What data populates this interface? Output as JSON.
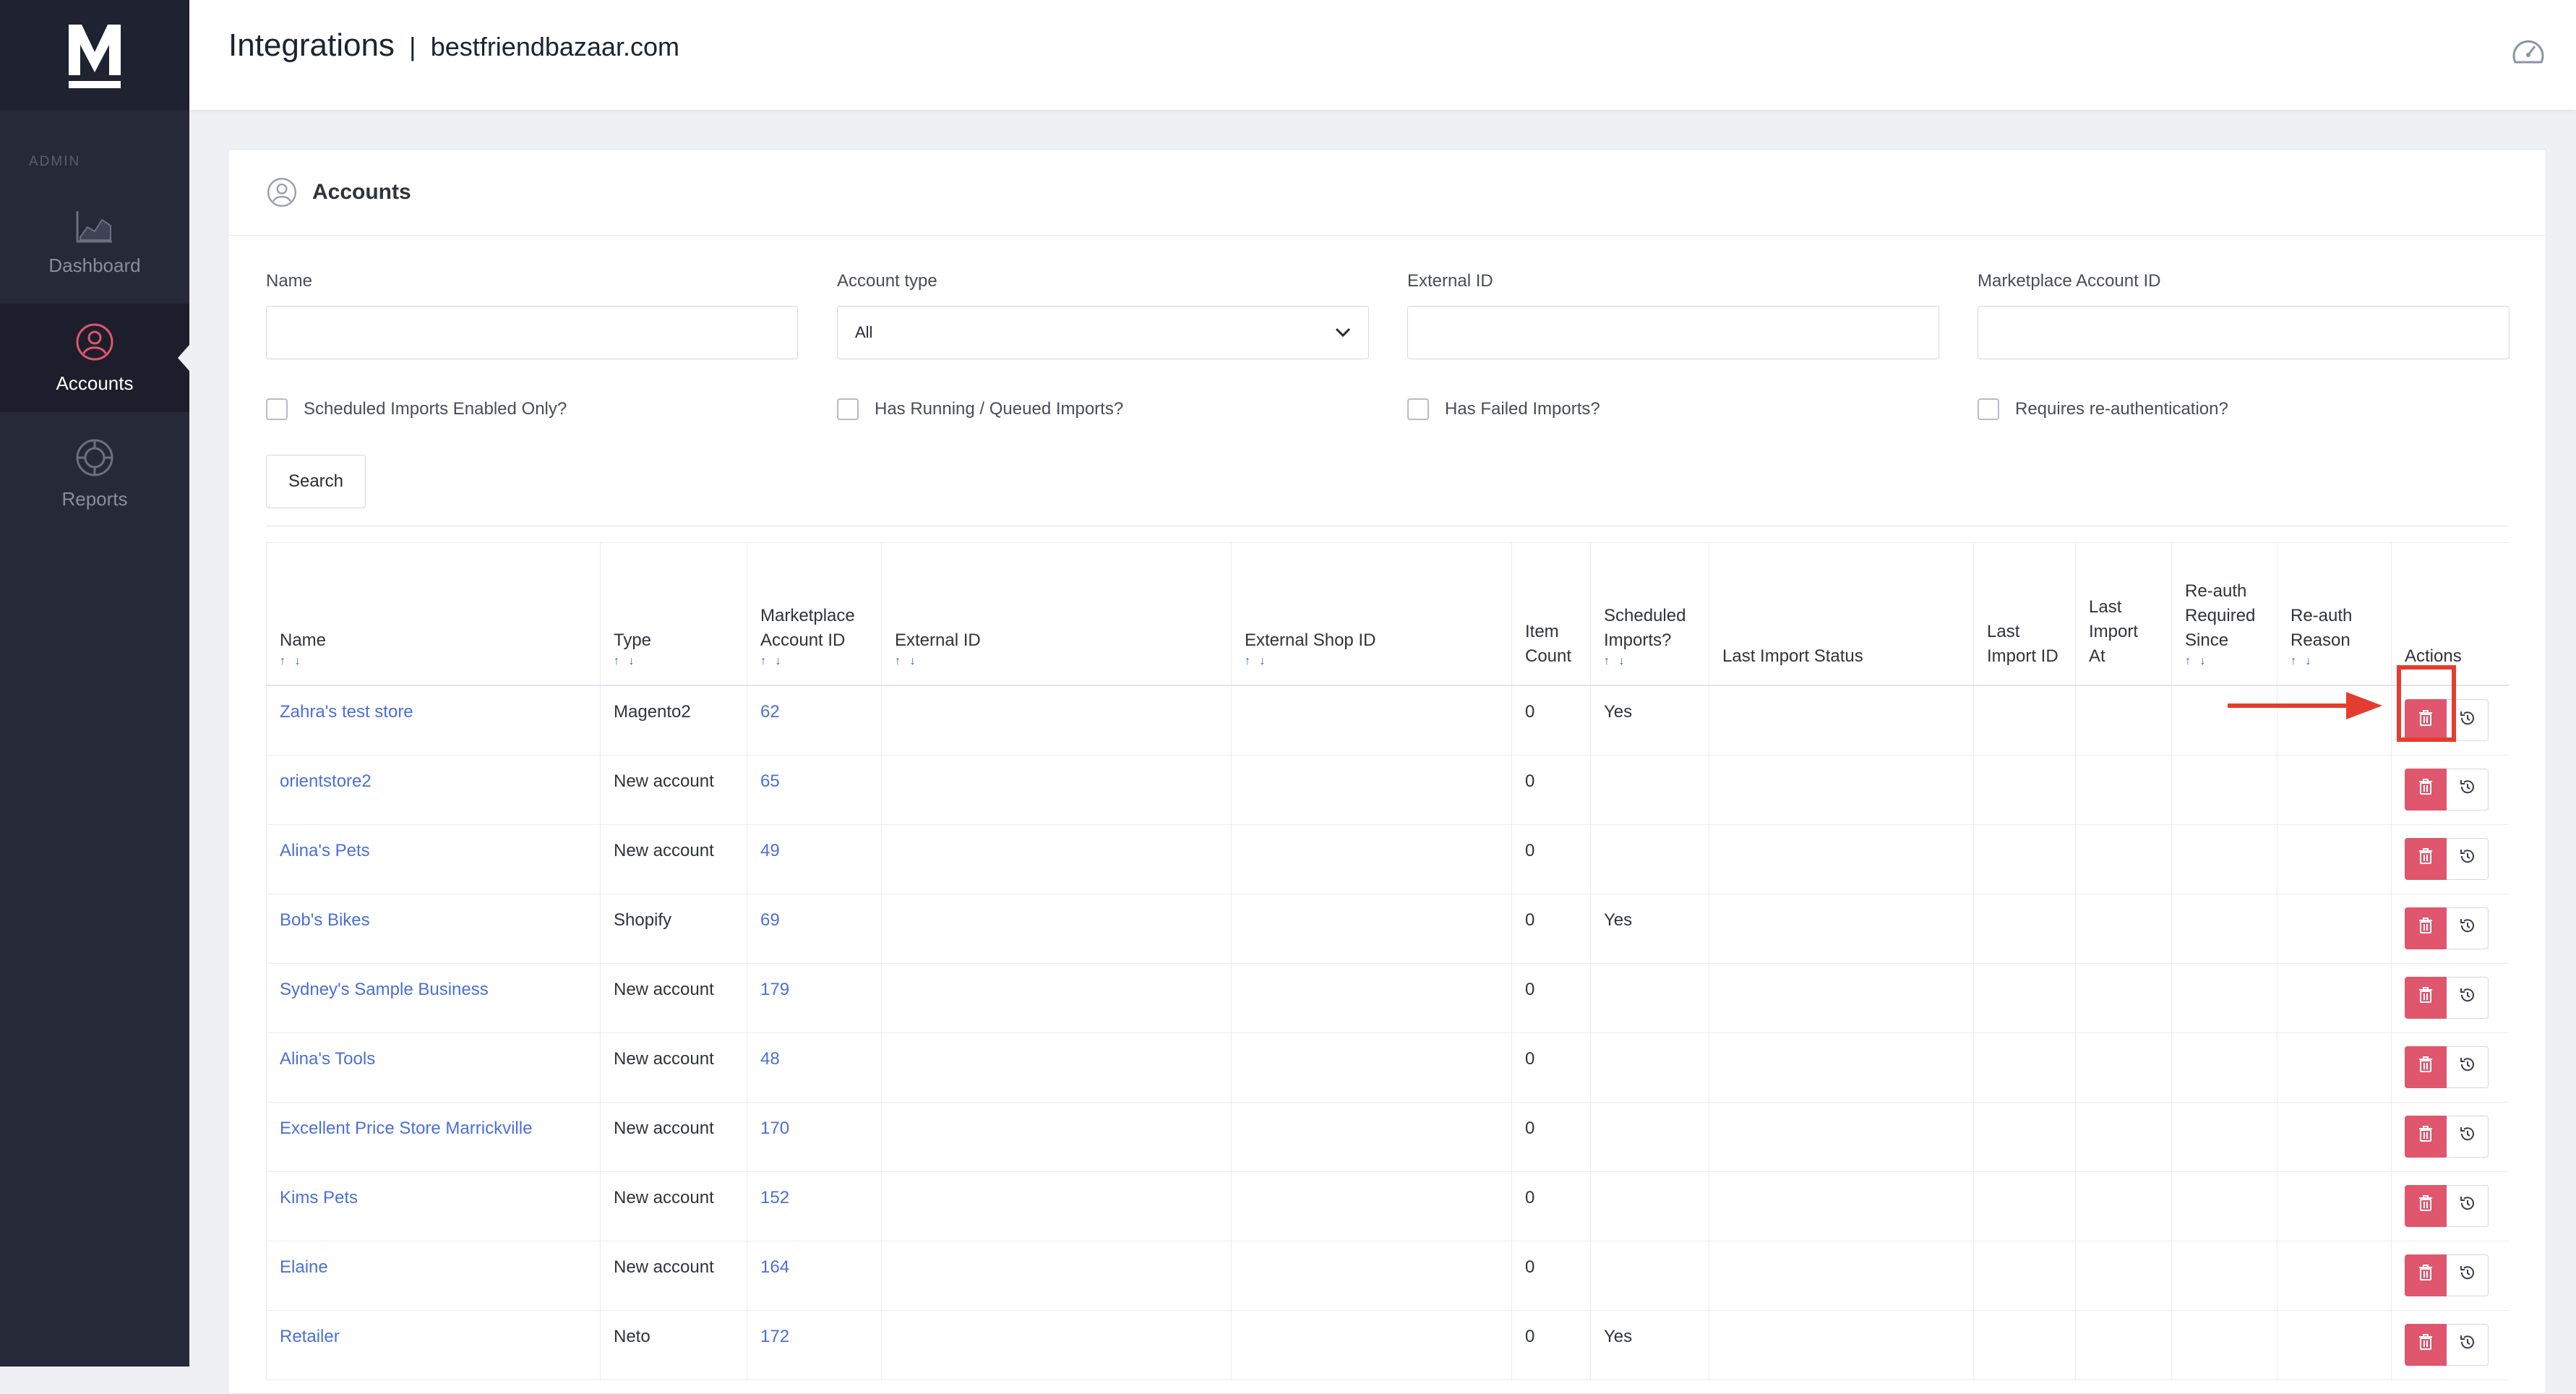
{
  "app": {
    "logo_letter": "M",
    "admin_label": "ADMIN"
  },
  "sidebar": {
    "items": [
      {
        "label": "Dashboard",
        "icon": "chart-icon",
        "active": false
      },
      {
        "label": "Accounts",
        "icon": "user-circle-icon",
        "active": true
      },
      {
        "label": "Reports",
        "icon": "reports-icon",
        "active": false
      }
    ]
  },
  "header": {
    "title": "Integrations",
    "separator": "|",
    "domain": "bestfriendbazaar.com",
    "right_icon": "speedometer-icon"
  },
  "card": {
    "title": "Accounts",
    "icon": "user-circle-icon"
  },
  "filters": {
    "name": {
      "label": "Name",
      "value": ""
    },
    "account_type": {
      "label": "Account type",
      "value": "All"
    },
    "external_id": {
      "label": "External ID",
      "value": ""
    },
    "marketplace_account_id": {
      "label": "Marketplace Account ID",
      "value": ""
    },
    "checkboxes": [
      {
        "label": "Scheduled Imports Enabled Only?",
        "checked": false
      },
      {
        "label": "Has Running / Queued Imports?",
        "checked": false
      },
      {
        "label": "Has Failed Imports?",
        "checked": false
      },
      {
        "label": "Requires re-authentication?",
        "checked": false
      }
    ],
    "search_label": "Search"
  },
  "table": {
    "sort_glyph": "↑ ↓",
    "columns": [
      {
        "label": "Name",
        "sortable": true
      },
      {
        "label": "Type",
        "sortable": true
      },
      {
        "label": "Marketplace Account ID",
        "sortable": true
      },
      {
        "label": "External ID",
        "sortable": true
      },
      {
        "label": "External Shop ID",
        "sortable": true
      },
      {
        "label": "Item Count",
        "sortable": false
      },
      {
        "label": "Scheduled Imports?",
        "sortable": true
      },
      {
        "label": "Last Import Status",
        "sortable": false
      },
      {
        "label": "Last Import ID",
        "sortable": false
      },
      {
        "label": "Last Import At",
        "sortable": false
      },
      {
        "label": "Re-auth Required Since",
        "sortable": true
      },
      {
        "label": "Re-auth Reason",
        "sortable": true
      },
      {
        "label": "Actions",
        "sortable": false
      }
    ],
    "rows": [
      {
        "name": "Zahra's test store",
        "type": "Magento2",
        "marketplace_id": "62",
        "item_count": "0",
        "scheduled": "Yes"
      },
      {
        "name": "orientstore2",
        "type": "New account",
        "marketplace_id": "65",
        "item_count": "0",
        "scheduled": ""
      },
      {
        "name": "Alina's Pets",
        "type": "New account",
        "marketplace_id": "49",
        "item_count": "0",
        "scheduled": ""
      },
      {
        "name": "Bob's Bikes",
        "type": "Shopify",
        "marketplace_id": "69",
        "item_count": "0",
        "scheduled": "Yes"
      },
      {
        "name": "Sydney's Sample Business",
        "type": "New account",
        "marketplace_id": "179",
        "item_count": "0",
        "scheduled": ""
      },
      {
        "name": " Alina's Tools",
        "type": "New account",
        "marketplace_id": "48",
        "item_count": "0",
        "scheduled": ""
      },
      {
        "name": "Excellent Price Store Marrickville",
        "type": "New account",
        "marketplace_id": "170",
        "item_count": "0",
        "scheduled": ""
      },
      {
        "name": "Kims Pets",
        "type": "New account",
        "marketplace_id": "152",
        "item_count": "0",
        "scheduled": ""
      },
      {
        "name": "Elaine",
        "type": "New account",
        "marketplace_id": "164",
        "item_count": "0",
        "scheduled": ""
      },
      {
        "name": "Retailer",
        "type": "Neto",
        "marketplace_id": "172",
        "item_count": "0",
        "scheduled": "Yes"
      }
    ]
  },
  "colors": {
    "sidebar_bg": "#262938",
    "accent_red": "#e0566d",
    "link_blue": "#4a6fd8",
    "annotation_red": "#e43d2f"
  }
}
